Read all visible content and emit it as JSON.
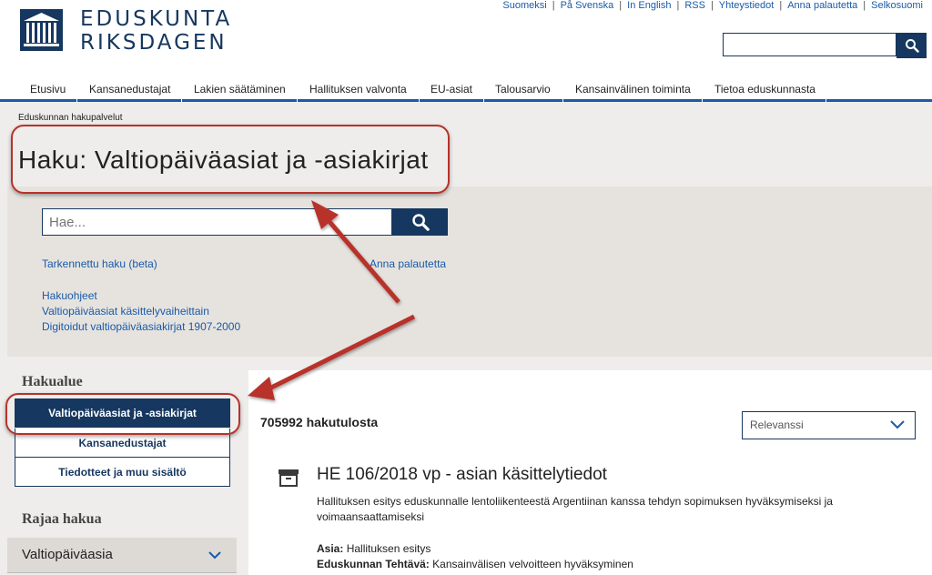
{
  "header": {
    "logo_line1": "EDUSKUNTA",
    "logo_line2": "RIKSDAGEN",
    "top_links": [
      "Suomeksi",
      "På Svenska",
      "In English",
      "RSS",
      "Yhteystiedot",
      "Anna palautetta",
      "Selkosuomi"
    ],
    "nav": [
      "Etusivu",
      "Kansanedustajat",
      "Lakien säätäminen",
      "Hallituksen valvonta",
      "EU-asiat",
      "Talousarvio",
      "Kansainvälinen toiminta",
      "Tietoa eduskunnasta"
    ]
  },
  "breadcrumb": "Eduskunnan hakupalvelut",
  "page_title": "Haku: Valtiopäiväasiat ja -asiakirjat",
  "search": {
    "placeholder": "Hae...",
    "advanced_link": "Tarkennettu haku (beta)",
    "feedback_link": "Anna palautetta",
    "help_links": [
      "Hakuohjeet",
      "Valtiopäiväasiat käsittelyvaiheittain",
      "Digitoidut valtiopäiväasiakirjat 1907-2000"
    ]
  },
  "sidebar": {
    "scope_heading": "Hakualue",
    "scopes": [
      "Valtiopäiväasiat ja -asiakirjat",
      "Kansanedustajat",
      "Tiedotteet ja muu sisältö"
    ],
    "filter_heading": "Rajaa hakua",
    "filter_label": "Valtiopäiväasia"
  },
  "results": {
    "count_text": "705992 hakutulosta",
    "sort_label": "Relevanssi",
    "item": {
      "title": "HE 106/2018 vp - asian käsittelytiedot",
      "description_line1": "Hallituksen esitys eduskunnalle lentoliikenteestä Argentiinan kanssa tehdyn sopimuksen hyväksymiseksi ja",
      "description_line2": "voimaansaattamiseksi",
      "asia_label": "Asia:",
      "asia_value": "Hallituksen esitys",
      "tehtava_label": "Eduskunnan Tehtävä:",
      "tehtava_value": "Kansainvälisen velvoitteen hyväksyminen"
    }
  },
  "icons": [
    "parliament-logo-icon",
    "search-icon",
    "chevron-down-icon",
    "archive-box-icon"
  ],
  "colors": {
    "brand": "#16375f",
    "link": "#1a5aa8",
    "annotation": "#b8322a"
  }
}
